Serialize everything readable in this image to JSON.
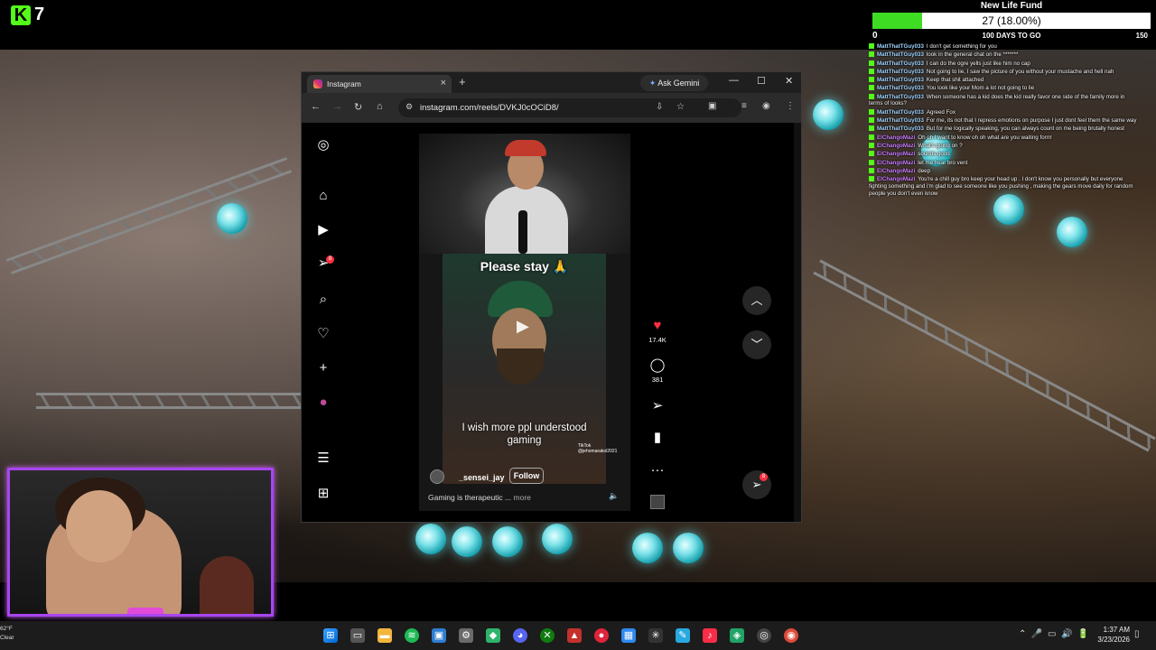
{
  "stream": {
    "viewer_count": "7"
  },
  "fund": {
    "title": "New Life Fund",
    "amount_label": "27 (18.00%)",
    "progress_fraction": 0.18,
    "min_label": "0",
    "days_label": "100 DAYS TO GO",
    "max_label": "150"
  },
  "chat": [
    {
      "user": "MattThatTGuy033",
      "text": "I don't get something for you"
    },
    {
      "user": "MattThatTGuy033",
      "text": "look in the general chat on the *******"
    },
    {
      "user": "MattThatTGuy033",
      "text": "I can do the ogre yells just like him no cap"
    },
    {
      "user": "MattThatTGuy033",
      "text": "Not going to lie, I saw the picture of you without your mustache and hell nah"
    },
    {
      "user": "MattThatTGuy033",
      "text": "Keep that shit attached"
    },
    {
      "user": "MattThatTGuy033",
      "text": "You look like your Mom a lot not going to lie"
    },
    {
      "user": "MattThatTGuy033",
      "text": "When someone has a kid does the kid really favor one side of the family more in terms of looks?"
    },
    {
      "user": "MattThatTGuy033",
      "text": "Agreed Fox"
    },
    {
      "user": "MattThatTGuy033",
      "text": "For me, its not that I repress emotions on purpose I just dont feel them the same way"
    },
    {
      "user": "MattThatTGuy033",
      "text": "But for me logically speaking, you can always count on me being brutally honest"
    },
    {
      "user": "ElChangoMazi",
      "text": "Oh oh I want to know oh oh what are you waiting forrrr"
    },
    {
      "user": "ElChangoMazi",
      "text": "What's going on ?"
    },
    {
      "user": "ElChangoMazi",
      "text": "sounds good"
    },
    {
      "user": "ElChangoMazi",
      "text": "let me hear bro vent"
    },
    {
      "user": "ElChangoMazi",
      "text": "deep"
    },
    {
      "user": "ElChangoMazi",
      "text": "You're a chill guy bro keep your head up . I don't know you personally but everyone fighting something and i'm glad to see someone like you pushing , making the gears move daily for random people you don't even know"
    }
  ],
  "browser": {
    "tab_title": "Instagram",
    "ask_gemini": "Ask Gemini",
    "url": "instagram.com/reels/DVKJ0cOCiD8/"
  },
  "instagram": {
    "messages_badge": "8",
    "reel": {
      "caption_top": "Please stay 🙏",
      "caption_bottom": "I wish more ppl understood gaming",
      "watermark": "TikTok @jehomarakol2021",
      "author": "_sensei_jay",
      "follow_label": "Follow",
      "description": "Gaming is therapeutic ...",
      "more_label": "more"
    },
    "likes": "17.4K",
    "comments": "381",
    "fab_badge": "8"
  },
  "taskbar": {
    "weather_temp": "62°F",
    "weather_cond": "Clear",
    "time": "1:37 AM",
    "date": "3/23/2026"
  },
  "colors": {
    "accent_green": "#53fc18",
    "fund_fill": "#3fdc24",
    "instagram_red": "#ff3040",
    "webcam_border": "#a845f0"
  }
}
